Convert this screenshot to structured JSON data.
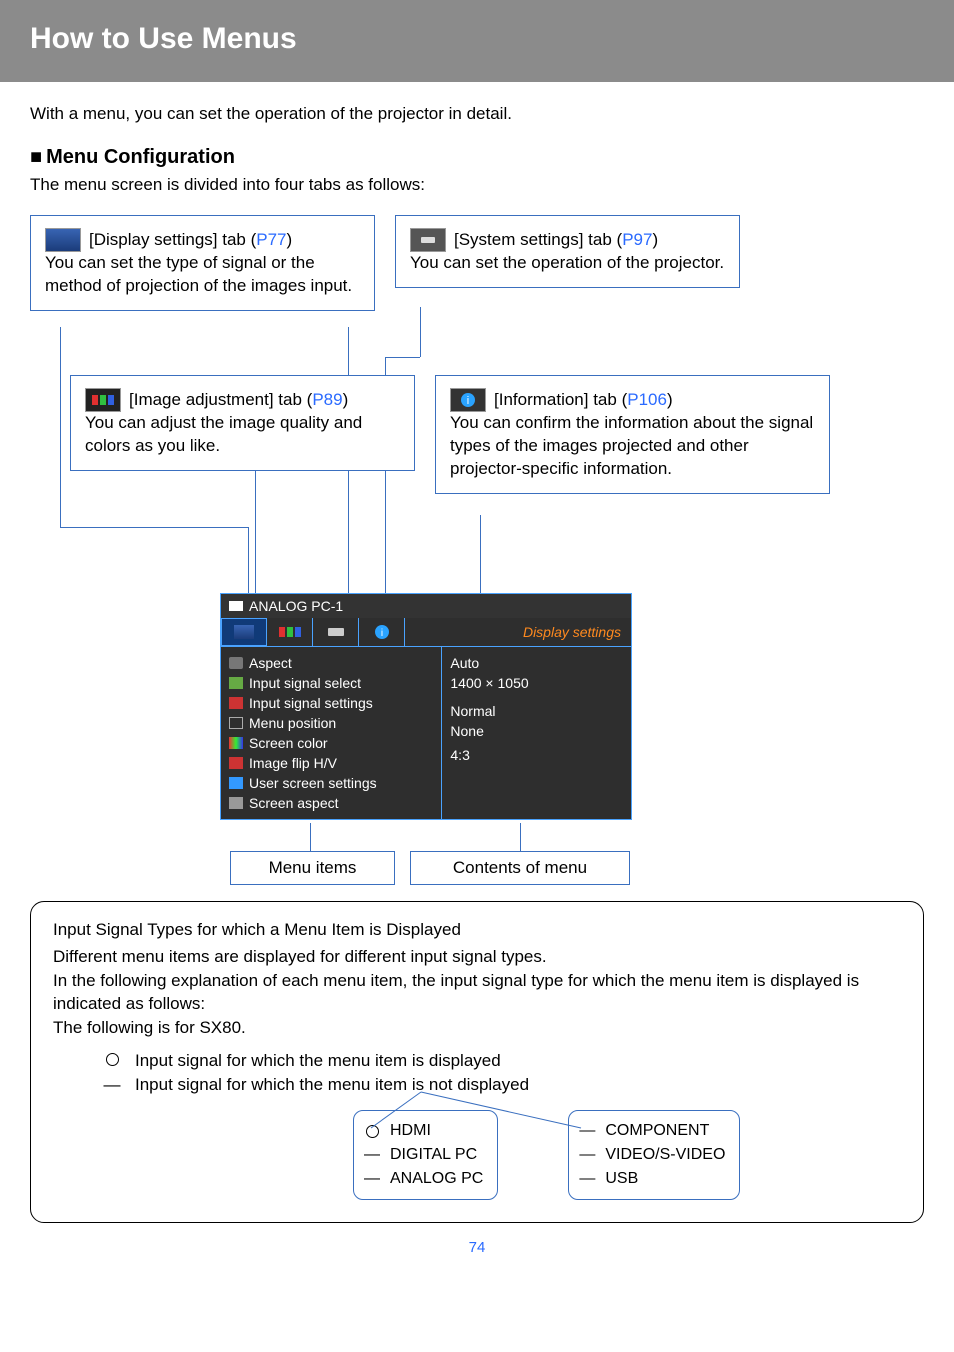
{
  "page": {
    "title": "How to Use Menus",
    "intro": "With a menu, you can set the operation of the projector in detail.",
    "section_marker": "■",
    "section_heading": "Menu Configuration",
    "section_desc": "The menu screen is divided into four tabs as follows:",
    "number": "74"
  },
  "callouts": {
    "display": {
      "label_pre": "[Display settings] tab (",
      "page": "P77",
      "label_post": ")",
      "desc": "You can set the type of signal or the method of projection of the images input."
    },
    "system": {
      "label_pre": "[System settings] tab (",
      "page": "P97",
      "label_post": ")",
      "desc": "You can set the operation of the projector."
    },
    "image": {
      "label_pre": "[Image adjustment] tab (",
      "page": "P89",
      "label_post": ")",
      "desc": "You can adjust the image quality and colors as you like."
    },
    "info": {
      "label_pre": "[Information] tab (",
      "page": "P106",
      "label_post": ")",
      "desc": "You can confirm the information about the signal types of the images projected and other projector-specific information."
    }
  },
  "proj_menu": {
    "signal": "ANALOG PC-1",
    "active_tab_title": "Display settings",
    "items": [
      {
        "label": "Aspect",
        "value": "Auto"
      },
      {
        "label": "Input signal select",
        "value": "1400 × 1050"
      },
      {
        "label": "Input signal settings",
        "value": ""
      },
      {
        "label": "Menu position",
        "value": ""
      },
      {
        "label": "Screen color",
        "value": "Normal"
      },
      {
        "label": "Image flip H/V",
        "value": "None"
      },
      {
        "label": "User screen settings",
        "value": ""
      },
      {
        "label": "Screen aspect",
        "value": "4:3"
      }
    ],
    "label_menu_items": "Menu items",
    "label_contents": "Contents of menu"
  },
  "info_panel": {
    "heading": "Input Signal Types for which a Menu Item is Displayed",
    "line1": "Different menu items are displayed for different input signal types.",
    "line2": "In the following explanation of each menu item, the input signal type for which the menu item is displayed is indicated as follows:",
    "line3": "The following is for SX80.",
    "legend_yes": "Input signal for which the menu item is displayed",
    "legend_no": "Input signal for which the menu item is not displayed",
    "signals_left": [
      {
        "sym": "circle",
        "label": "HDMI"
      },
      {
        "sym": "dash",
        "label": "DIGITAL PC"
      },
      {
        "sym": "dash",
        "label": "ANALOG PC"
      }
    ],
    "signals_right": [
      {
        "sym": "dash",
        "label": "COMPONENT"
      },
      {
        "sym": "dash",
        "label": "VIDEO/S-VIDEO"
      },
      {
        "sym": "dash",
        "label": "USB"
      }
    ]
  }
}
